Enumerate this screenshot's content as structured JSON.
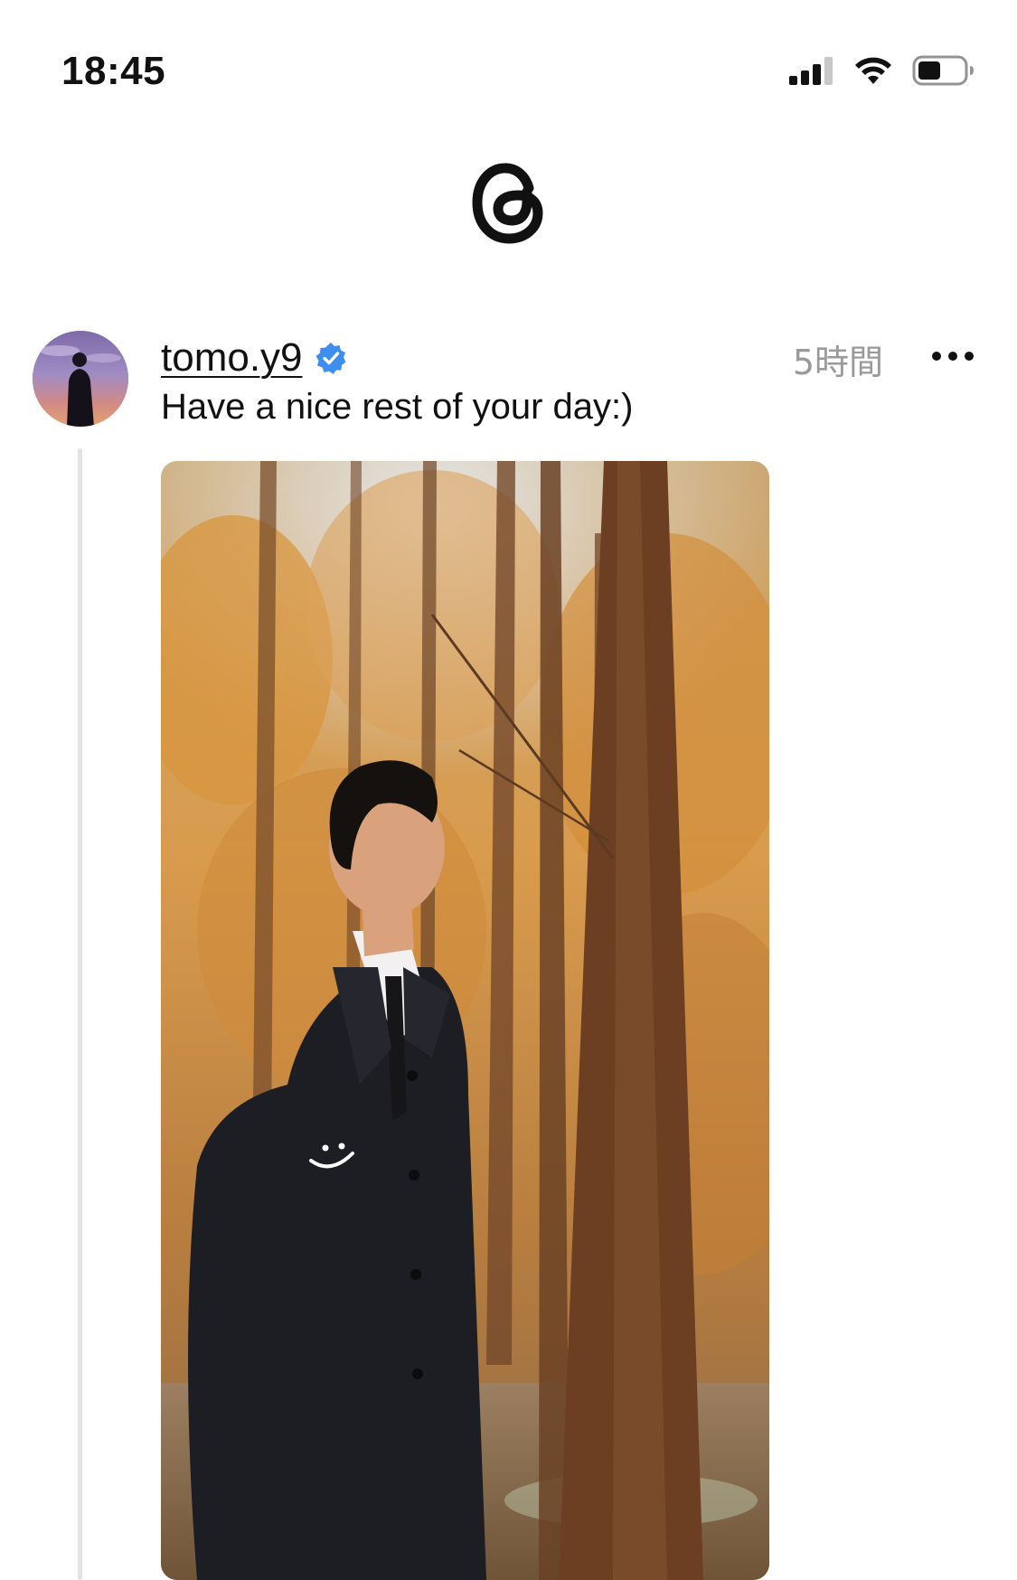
{
  "status_bar": {
    "time": "18:45",
    "icons": [
      "cellular-signal-icon",
      "wifi-icon",
      "battery-icon"
    ]
  },
  "header": {
    "logo": "threads-logo-icon"
  },
  "post": {
    "username": "tomo.y9",
    "verified": true,
    "timestamp": "5時間",
    "caption": "Have a nice rest of your day:)",
    "more_icon": "more-options-icon",
    "image_alt_icon": "post-photo"
  },
  "colors": {
    "verified_blue": "#3d8ef0",
    "timestamp_gray": "#9a9a9a",
    "thread_line": "#e3e3e3",
    "text": "#111111",
    "background": "#ffffff"
  }
}
